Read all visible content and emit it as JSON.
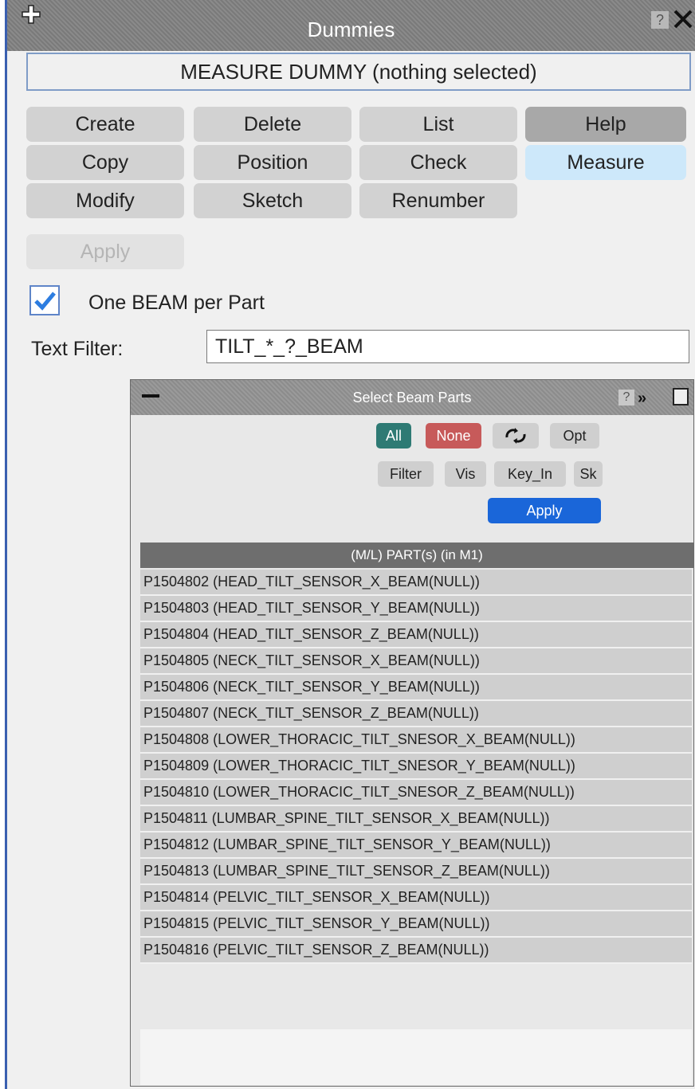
{
  "window": {
    "title": "Dummies",
    "subtitle": "MEASURE DUMMY (nothing selected)",
    "help_label": "?"
  },
  "actions": {
    "create": "Create",
    "delete": "Delete",
    "list": "List",
    "help": "Help",
    "copy": "Copy",
    "position": "Position",
    "check": "Check",
    "measure": "Measure",
    "modify": "Modify",
    "sketch": "Sketch",
    "renumber": "Renumber",
    "apply": "Apply"
  },
  "options": {
    "one_beam_per_part_label": "One BEAM per Part",
    "one_beam_per_part_checked": true
  },
  "text_filter": {
    "label": "Text Filter:",
    "value": "TILT_*_?_BEAM"
  },
  "select_panel": {
    "title": "Select Beam Parts",
    "help_label": "?",
    "buttons": {
      "all": "All",
      "none": "None",
      "opt": "Opt",
      "filter": "Filter",
      "vis": "Vis",
      "key_in": "Key_In",
      "sk": "Sk",
      "apply": "Apply"
    },
    "colors": {
      "all": "#2e7a74",
      "none": "#c75a5a",
      "apply": "#1a66d9"
    },
    "list_header": "(M/L) PART(s) (in M1)",
    "rows": [
      "P1504802 (HEAD_TILT_SENSOR_X_BEAM(NULL))",
      "P1504803 (HEAD_TILT_SENSOR_Y_BEAM(NULL))",
      "P1504804 (HEAD_TILT_SENSOR_Z_BEAM(NULL))",
      "P1504805 (NECK_TILT_SENSOR_X_BEAM(NULL))",
      "P1504806 (NECK_TILT_SENSOR_Y_BEAM(NULL))",
      "P1504807 (NECK_TILT_SENSOR_Z_BEAM(NULL))",
      "P1504808 (LOWER_THORACIC_TILT_SNESOR_X_BEAM(NULL))",
      "P1504809 (LOWER_THORACIC_TILT_SNESOR_Y_BEAM(NULL))",
      "P1504810 (LOWER_THORACIC_TILT_SNESOR_Z_BEAM(NULL))",
      "P1504811 (LUMBAR_SPINE_TILT_SENSOR_X_BEAM(NULL))",
      "P1504812 (LUMBAR_SPINE_TILT_SENSOR_Y_BEAM(NULL))",
      "P1504813 (LUMBAR_SPINE_TILT_SENSOR_Z_BEAM(NULL))",
      "P1504814 (PELVIC_TILT_SENSOR_X_BEAM(NULL))",
      "P1504815 (PELVIC_TILT_SENSOR_Y_BEAM(NULL))",
      "P1504816 (PELVIC_TILT_SENSOR_Z_BEAM(NULL))"
    ]
  }
}
